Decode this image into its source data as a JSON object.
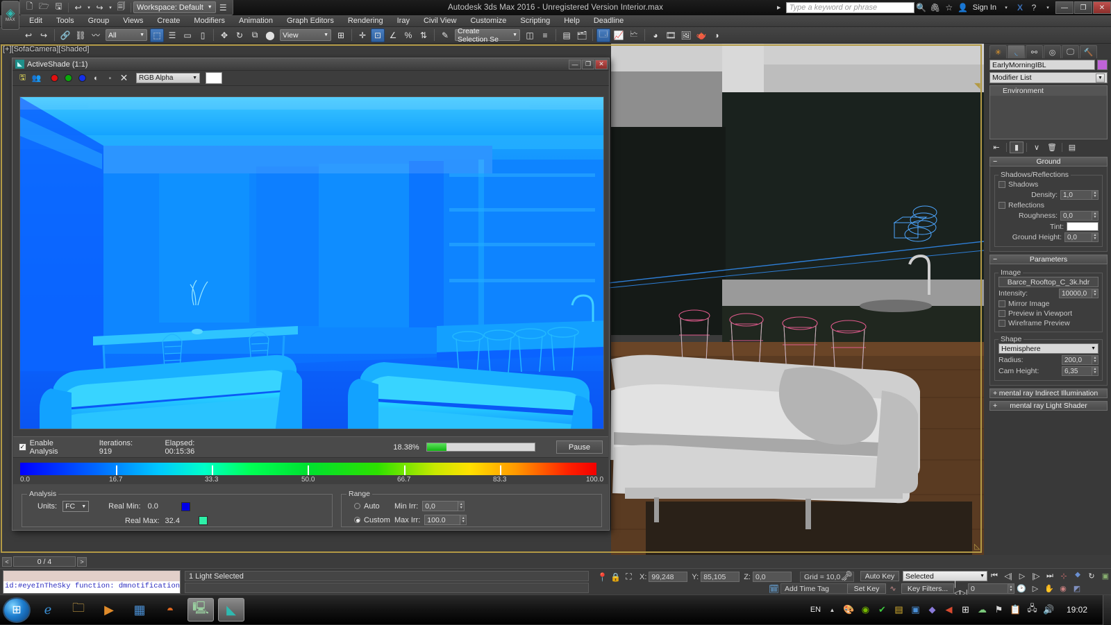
{
  "titlebar": {
    "app_title": "Autodesk 3ds Max 2016 - Unregistered Version    Interior.max",
    "workspace": "Workspace: Default",
    "search_placeholder": "Type a keyword or phrase",
    "signin": "Sign In",
    "minimize": "—",
    "restore": "❐",
    "close": "✕",
    "quick_icons": [
      "new-icon",
      "open-icon",
      "save-icon",
      "undo-icon",
      "redo-icon",
      "set-project-icon"
    ]
  },
  "menu": {
    "items": [
      "Edit",
      "Tools",
      "Group",
      "Views",
      "Create",
      "Modifiers",
      "Animation",
      "Graph Editors",
      "Rendering",
      "Iray",
      "Civil View",
      "Customize",
      "Scripting",
      "Help",
      "Deadline"
    ]
  },
  "toolbar": {
    "selection_filter": "All",
    "reference_coord": "View",
    "named_selection": "Create Selection Se"
  },
  "viewport": {
    "label": "[+][SofaCamera][Shaded]"
  },
  "command_panel": {
    "tabs": [
      "create-tab",
      "modify-tab",
      "hierarchy-tab",
      "motion-tab",
      "display-tab",
      "utilities-tab"
    ],
    "object_name": "EarlyMorningIBL",
    "object_color": "#c063d8",
    "modifier_list": "Modifier List",
    "stack": [
      "Environment"
    ],
    "rollouts": {
      "ground": {
        "title": "Ground",
        "group_label": "Shadows/Reflections",
        "shadows_label": "Shadows",
        "density_label": "Density:",
        "density_value": "1,0",
        "reflections_label": "Reflections",
        "roughness_label": "Roughness:",
        "roughness_value": "0,0",
        "tint_label": "Tint:",
        "tint_color": "#ffffff",
        "ground_height_label": "Ground Height:",
        "ground_height_value": "0,0"
      },
      "parameters": {
        "title": "Parameters",
        "image_group": "Image",
        "image_file": "Barce_Rooftop_C_3k.hdr",
        "intensity_label": "Intensity:",
        "intensity_value": "10000,0",
        "mirror_image": "Mirror Image",
        "preview_viewport": "Preview in Viewport",
        "wireframe_preview": "Wireframe Preview",
        "shape_group": "Shape",
        "shape_value": "Hemisphere",
        "radius_label": "Radius:",
        "radius_value": "200,0",
        "cam_height_label": "Cam Height:",
        "cam_height_value": "6,35"
      },
      "collapsed": [
        "mental ray Indirect Illumination",
        "mental ray Light Shader"
      ]
    }
  },
  "activeshade": {
    "title": "ActiveShade (1:1)",
    "minimize": "—",
    "restore": "❐",
    "close": "✕",
    "toolbar": {
      "save_icon": "save-image-icon",
      "clone_icon": "clone-window-icon",
      "red_channel": "#e01010",
      "green_channel": "#0ba80b",
      "blue_channel": "#1430e8",
      "mono_icon": "monochrome-icon",
      "alpha_icon": "alpha-channel-icon",
      "clear_icon": "clear-icon",
      "channel_select": "RGB Alpha",
      "swatch_color": "#ffffff"
    },
    "status": {
      "enable_analysis": "Enable Analysis",
      "iterations": "Iterations: 919",
      "elapsed": "Elapsed: 00:15:36",
      "percent": "18.38%",
      "progress": 18.38,
      "pause": "Pause"
    },
    "analysis": {
      "group_label": "Analysis",
      "units_label": "Units:",
      "units_value": "FC",
      "real_min_label": "Real Min:",
      "real_min_value": "0.0",
      "real_min_color": "#0000e8",
      "real_max_label": "Real Max:",
      "real_max_value": "32.4",
      "real_max_color": "#2ef0a8"
    },
    "range": {
      "group_label": "Range",
      "auto_label": "Auto",
      "custom_label": "Custom",
      "selected": "Custom",
      "min_irr_label": "Min Irr:",
      "min_irr_value": "0,0",
      "max_irr_label": "Max Irr:",
      "max_irr_value": "100.0"
    },
    "gradient_ticks": [
      "0.0",
      "16.7",
      "33.3",
      "50.0",
      "66.7",
      "83.3",
      "100.0"
    ]
  },
  "timeslider": {
    "prev": "<",
    "next": ">",
    "frame": "0 / 4"
  },
  "statusbar": {
    "listener_text": "id:#eyeInTheSky   function: dmnotification(",
    "message": "1 Light Selected",
    "x_label": "X:",
    "x_value": "99,248",
    "y_label": "Y:",
    "y_value": "85,105",
    "z_label": "Z:",
    "z_value": "0,0",
    "grid": "Grid = 10,0",
    "time_tag": "Add Time Tag",
    "auto_key": "Auto Key",
    "set_key": "Set Key",
    "key_mode": "Selected",
    "key_filters": "Key Filters...",
    "key_frame": "0"
  },
  "taskbar": {
    "start": "start-orb",
    "apps": [
      "internet-explorer-icon",
      "file-explorer-icon",
      "media-player-icon",
      "excel-icon",
      "firefox-icon",
      "remote-desktop-icon",
      "3dsmax-icon"
    ],
    "language": "EN",
    "clock": "19:02",
    "tray": [
      "show-hidden-icon",
      "paint-icon",
      "nvidia-icon",
      "antivirus-icon",
      "spreadsheet-icon",
      "app-icon",
      "purple-icon",
      "volume-red-icon",
      "windows-icon",
      "sync-icon",
      "flag-icon",
      "clipboard-icon",
      "network-icon",
      "speaker-icon"
    ]
  }
}
